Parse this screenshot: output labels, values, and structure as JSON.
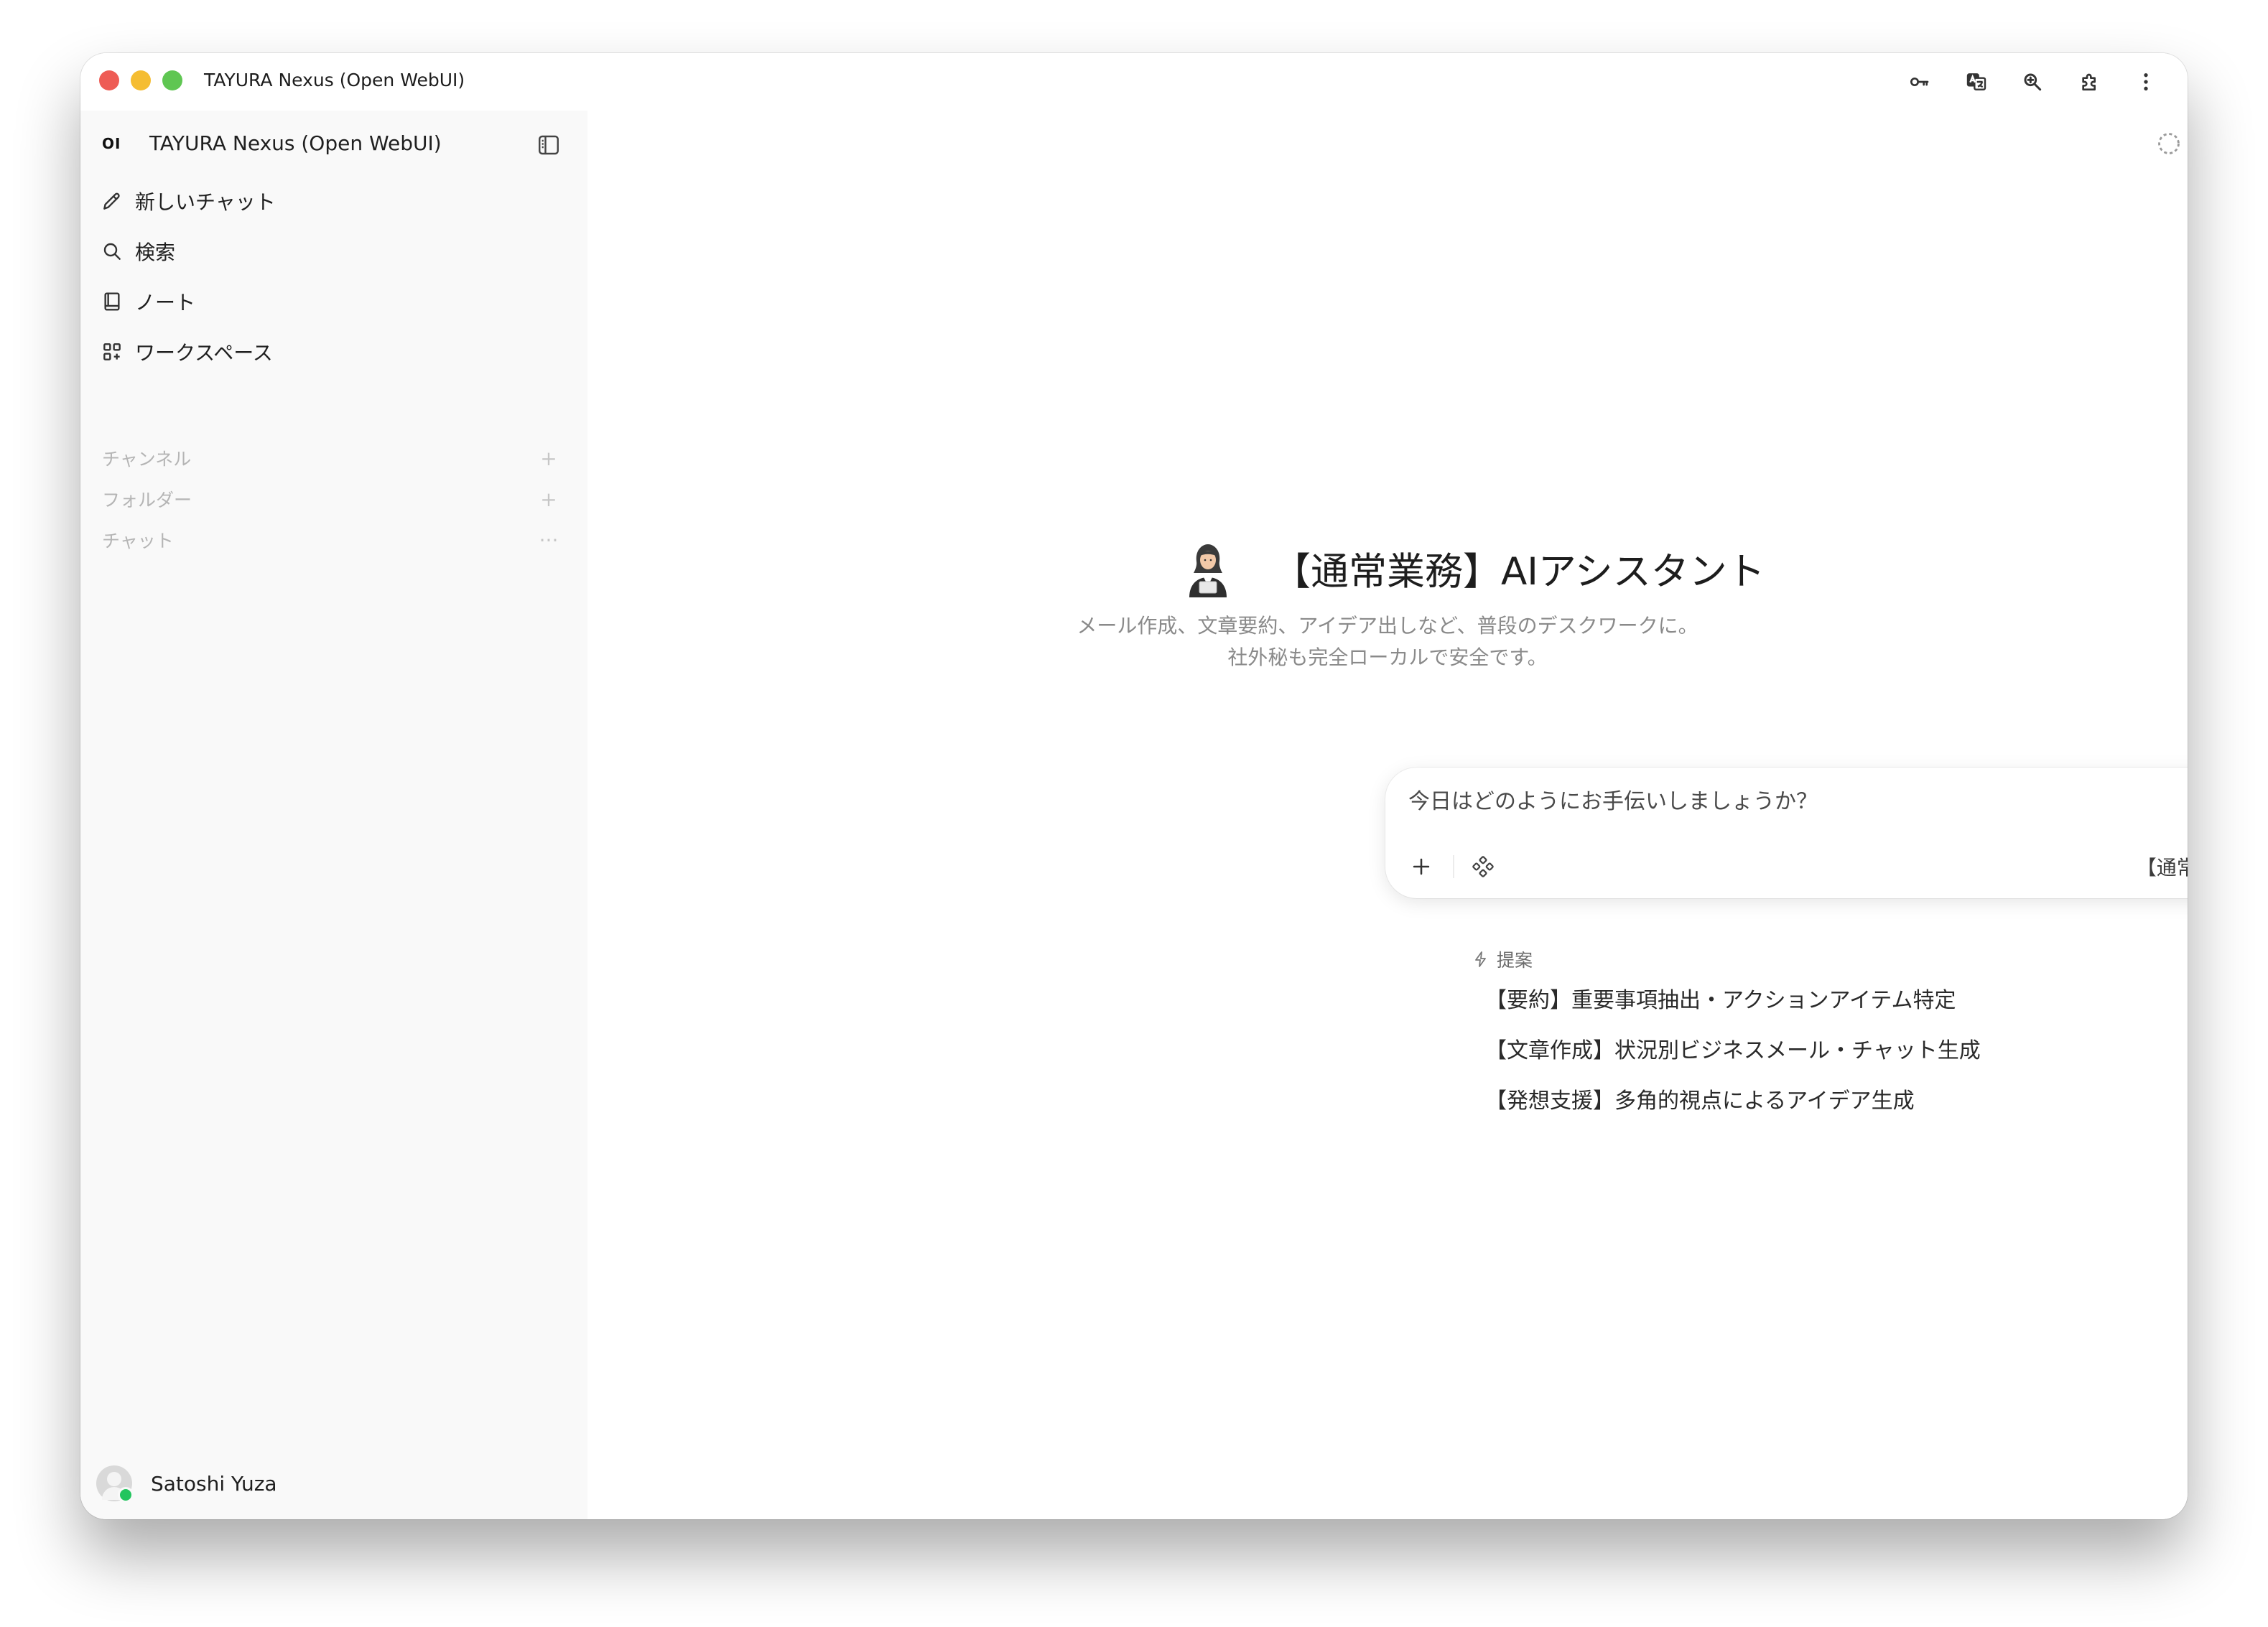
{
  "window": {
    "title": "TAYURA Nexus (Open WebUI)"
  },
  "toolbar_icons": [
    "key-icon",
    "translate-icon",
    "zoom-icon",
    "extensions-icon",
    "more-vertical-icon"
  ],
  "sidebar": {
    "logo": "OI",
    "app_name": "TAYURA Nexus (Open WebUI)",
    "nav": [
      {
        "label": "新しいチャット",
        "icon": "pencil-icon"
      },
      {
        "label": "検索",
        "icon": "search-icon"
      },
      {
        "label": "ノート",
        "icon": "notebook-icon"
      },
      {
        "label": "ワークスペース",
        "icon": "grid-icon"
      }
    ],
    "sections": [
      {
        "label": "チャンネル",
        "action": "+"
      },
      {
        "label": "フォルダー",
        "action": "+"
      },
      {
        "label": "チャット",
        "action": "···"
      }
    ],
    "user": {
      "name": "Satoshi Yuza",
      "status": "online"
    }
  },
  "main": {
    "title": "【通常業務】AIアシスタント",
    "description_line1": "メール作成、文章要約、アイデア出しなど、普段のデスクワークに。",
    "description_line2": "社外秘も完全ローカルで安全です。",
    "composer": {
      "placeholder": "今日はどのようにお手伝いしましょうか？",
      "model": "【通常業務】AIアシスタント"
    },
    "suggestions": {
      "heading": "提案",
      "items": [
        "【要約】重要事項抽出・アクションアイテム特定",
        "【文章作成】状況別ビジネスメール・チャット生成",
        "【発想支援】多角的視点によるアイデア生成"
      ]
    }
  },
  "colors": {
    "sidebar_bg": "#f9f9f9",
    "highlight_border": "#e0382e",
    "voice_button": "#0d0d0d",
    "online": "#22c55e"
  }
}
